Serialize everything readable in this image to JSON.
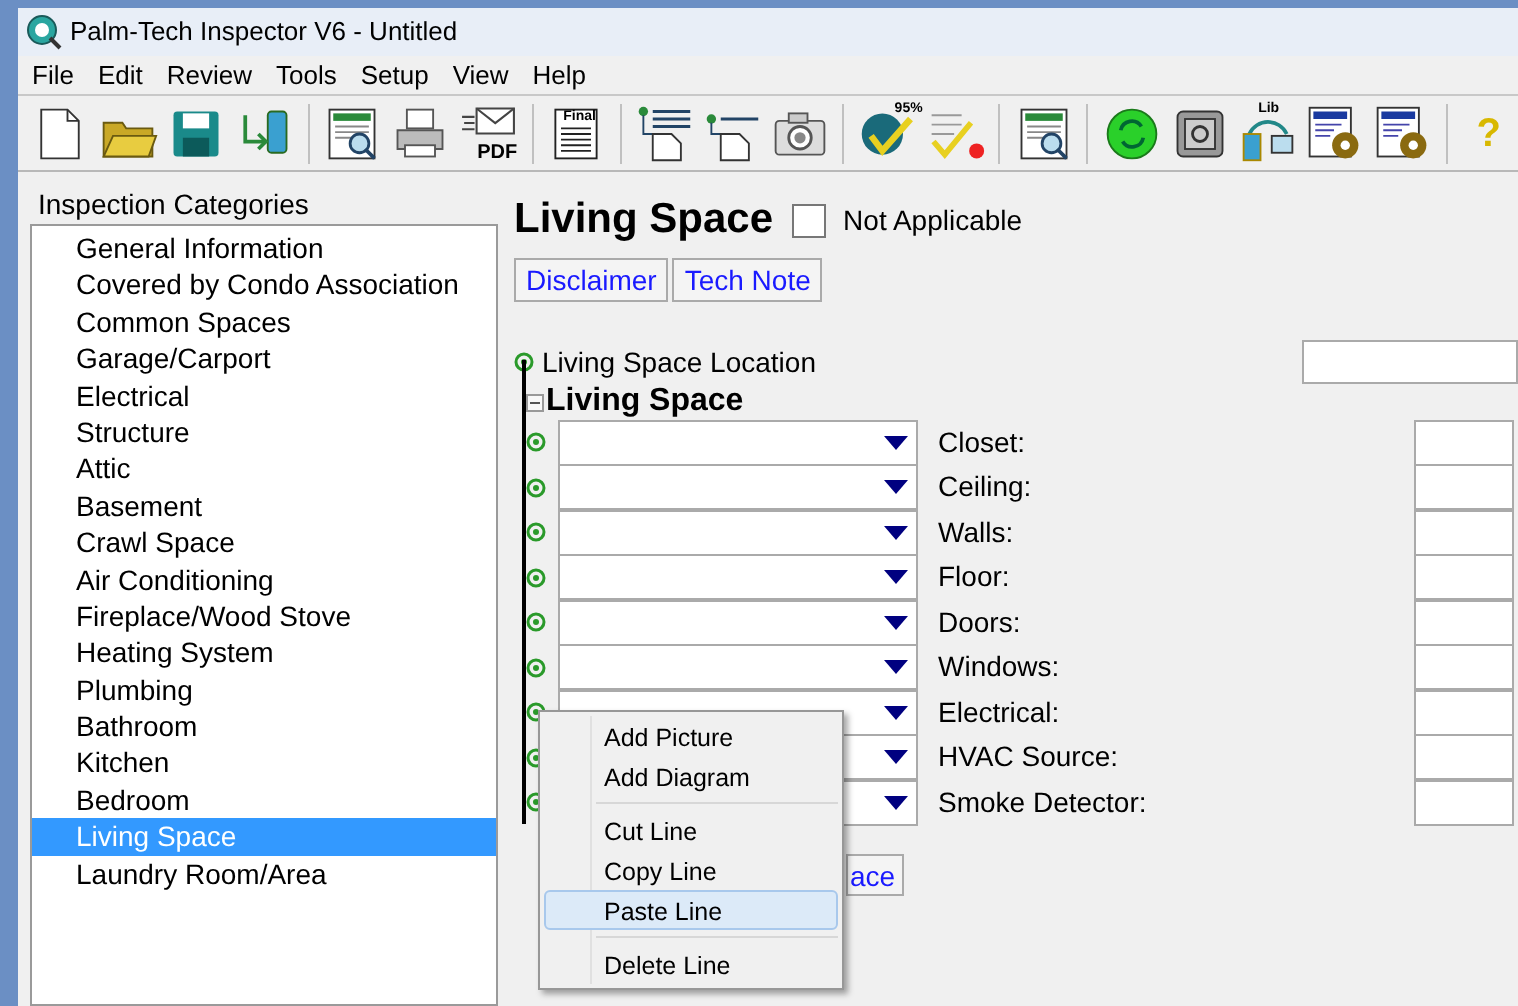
{
  "window": {
    "title": "Palm-Tech Inspector V6 - Untitled"
  },
  "menu": [
    "File",
    "Edit",
    "Review",
    "Tools",
    "Setup",
    "View",
    "Help"
  ],
  "toolbar": [
    {
      "kind": "new"
    },
    {
      "kind": "open"
    },
    {
      "kind": "save"
    },
    {
      "kind": "transfer"
    },
    {
      "kind": "sep"
    },
    {
      "kind": "preview"
    },
    {
      "kind": "print"
    },
    {
      "kind": "pdf",
      "label": "PDF"
    },
    {
      "kind": "sep"
    },
    {
      "kind": "final",
      "label": "Final"
    },
    {
      "kind": "sep"
    },
    {
      "kind": "lines"
    },
    {
      "kind": "line"
    },
    {
      "kind": "camera"
    },
    {
      "kind": "sep"
    },
    {
      "kind": "progress",
      "label": "95%"
    },
    {
      "kind": "check"
    },
    {
      "kind": "sep"
    },
    {
      "kind": "preview"
    },
    {
      "kind": "sep"
    },
    {
      "kind": "sync"
    },
    {
      "kind": "safe"
    },
    {
      "kind": "library",
      "label": "Lib"
    },
    {
      "kind": "settings"
    },
    {
      "kind": "settings"
    },
    {
      "kind": "sep"
    },
    {
      "kind": "help",
      "label": "?"
    }
  ],
  "sidebar": {
    "title": "Inspection Categories",
    "items": [
      {
        "label": "General Information",
        "selected": false
      },
      {
        "label": "Covered by Condo Association",
        "selected": false
      },
      {
        "label": "Common Spaces",
        "selected": false
      },
      {
        "label": "Garage/Carport",
        "selected": false
      },
      {
        "label": "Electrical",
        "selected": false
      },
      {
        "label": "Structure",
        "selected": false
      },
      {
        "label": "Attic",
        "selected": false
      },
      {
        "label": "Basement",
        "selected": false
      },
      {
        "label": "Crawl Space",
        "selected": false
      },
      {
        "label": "Air Conditioning",
        "selected": false
      },
      {
        "label": "Fireplace/Wood Stove",
        "selected": false
      },
      {
        "label": "Heating System",
        "selected": false
      },
      {
        "label": "Plumbing",
        "selected": false
      },
      {
        "label": "Bathroom",
        "selected": false
      },
      {
        "label": "Kitchen",
        "selected": false
      },
      {
        "label": "Bedroom",
        "selected": false
      },
      {
        "label": "Living Space",
        "selected": true
      },
      {
        "label": "Laundry Room/Area",
        "selected": false
      }
    ]
  },
  "content": {
    "title": "Living Space",
    "not_applicable": {
      "label": "Not Applicable",
      "checked": false
    },
    "buttons": [
      "Disclaimer",
      "Tech Note"
    ],
    "location_label": "Living Space Location",
    "section": {
      "title": "Living Space",
      "expanded": true,
      "rows": [
        "Closet:",
        "Ceiling:",
        "Walls:",
        "Floor:",
        "Doors:",
        "Windows:",
        "Electrical:",
        "HVAC Source:",
        "Smoke Detector:"
      ]
    },
    "bottom_button": "ace"
  },
  "context_menu": [
    {
      "kind": "item",
      "label": "Add Picture",
      "highlighted": false
    },
    {
      "kind": "item",
      "label": "Add Diagram",
      "highlighted": false
    },
    {
      "kind": "sep"
    },
    {
      "kind": "item",
      "label": "Cut Line",
      "highlighted": false
    },
    {
      "kind": "item",
      "label": "Copy Line",
      "highlighted": false
    },
    {
      "kind": "item",
      "label": "Paste Line",
      "highlighted": true
    },
    {
      "kind": "sep"
    },
    {
      "kind": "item",
      "label": "Delete Line",
      "highlighted": false
    }
  ]
}
